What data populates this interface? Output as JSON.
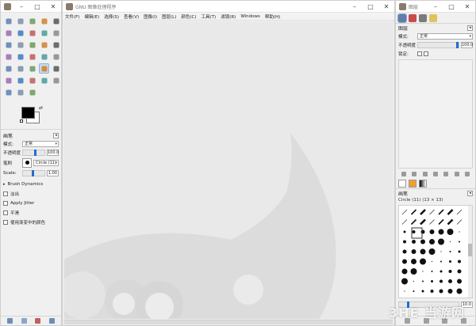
{
  "toolbox": {
    "title": "",
    "tool_rows": [
      [
        "rect-select-icon",
        "ellipse-select-icon",
        "free-select-icon",
        "fuzzy-select-icon",
        "zoom-icon"
      ],
      [
        "crop-icon",
        "paths-icon",
        "color-picker-icon",
        "measure-icon",
        "magnify-icon"
      ],
      [
        "move-icon",
        "align-icon",
        "rotate-icon",
        "scale-icon",
        "shear-icon"
      ],
      [
        "perspective-icon",
        "flip-icon",
        "cage-icon",
        "warp-icon",
        "text-icon"
      ],
      [
        "bucket-fill-icon",
        "blend-icon",
        "pencil-icon",
        "paintbrush-icon",
        "eraser-icon"
      ],
      [
        "airbrush-icon",
        "ink-icon",
        "clone-icon",
        "heal-icon",
        "perspective-clone-icon"
      ],
      [
        "blur-icon",
        "smudge-icon",
        "dodge-icon",
        "",
        ""
      ]
    ],
    "selected_tool": "paintbrush-icon",
    "options": {
      "header": "画笔",
      "mode_label": "模式:",
      "mode_value": "正常",
      "opacity_label": "不透明度",
      "opacity_value": "100.0",
      "brush_label": "笔刷",
      "brush_value": "Circle (11)",
      "size_label": "Scale:",
      "size_value": "1.00",
      "dynamics_label": "Brush Dynamics",
      "checks": [
        "淡出",
        "Apply Jitter",
        "平滑",
        "使用渐变中的颜色"
      ]
    }
  },
  "main": {
    "title": "GNU 图像处理程序",
    "menus": [
      "文件(F)",
      "编辑(E)",
      "选择(S)",
      "查看(V)",
      "图像(I)",
      "图层(L)",
      "颜色(C)",
      "工具(T)",
      "滤镜(R)",
      "Windows",
      "帮助(H)"
    ]
  },
  "docks": {
    "title": "图层",
    "layers": {
      "header": "图层",
      "mode_label": "模式:",
      "mode_value": "正常",
      "opacity_label": "不透明度",
      "opacity_value": "100.0",
      "lock_label": "锁定:"
    },
    "brushes": {
      "header": "画笔",
      "current": "Circle (11) (13 × 13)",
      "spacing_value": "10.0"
    }
  },
  "colors": {
    "accent": "#1f6fd0",
    "foreground": "#000000",
    "background": "#ffffff",
    "wilber": "#dcdcdc"
  },
  "watermark": {
    "logo_text": "3HE 当游网"
  }
}
